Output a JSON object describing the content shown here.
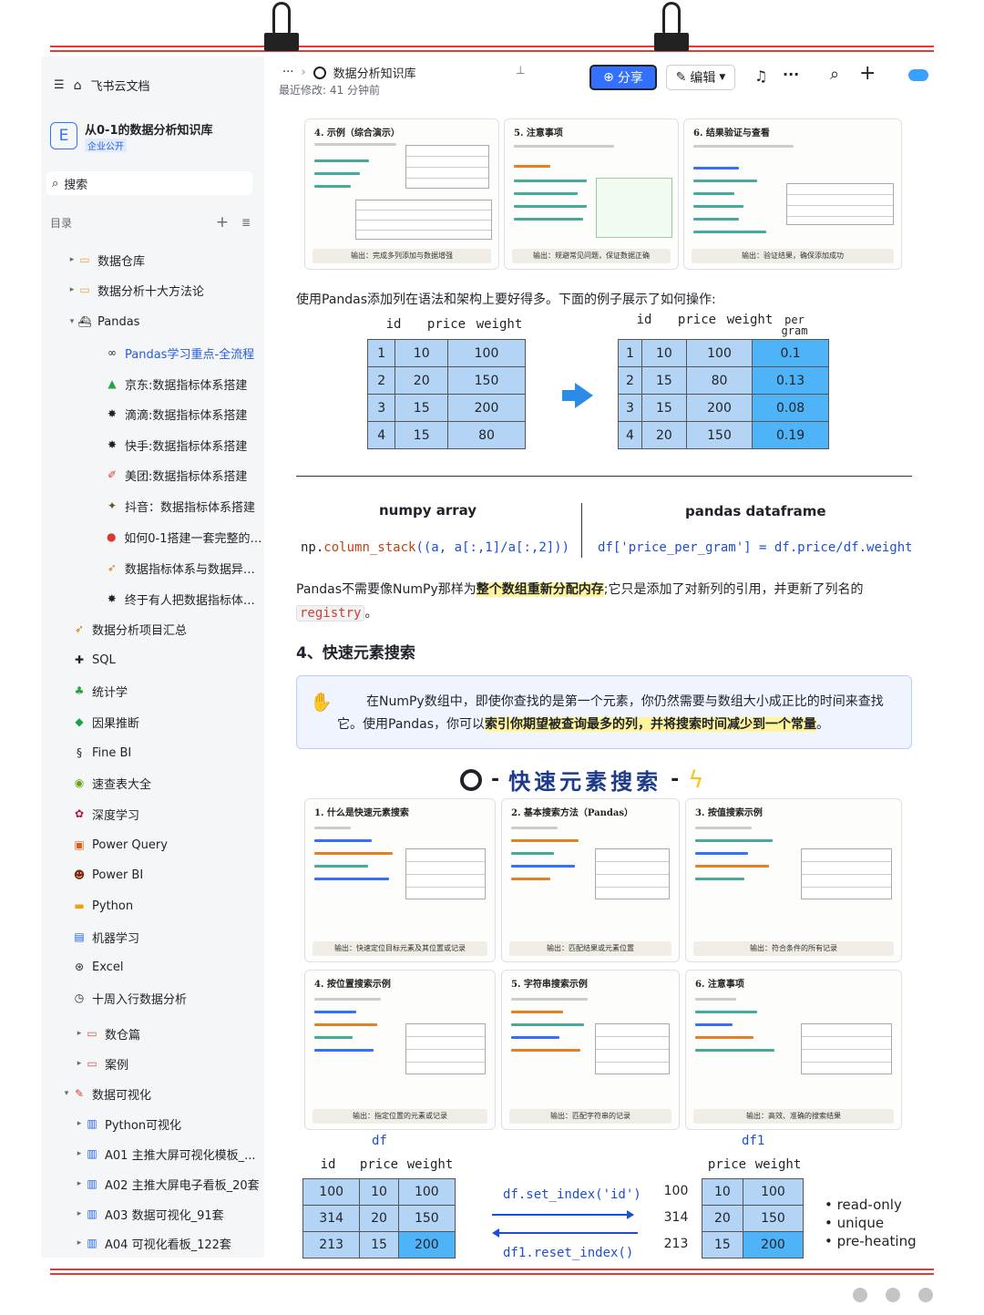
{
  "sidebar": {
    "app_name": "飞书云文档",
    "space_title": "从0-1的数据分析知识库",
    "space_badge": "企业公开",
    "space_letter": "E",
    "search_label": "搜索",
    "toc_label": "目录",
    "items": [
      {
        "label": "数据仓库",
        "icon": "folder-icon",
        "arrow": "▸",
        "indent": 1
      },
      {
        "label": "数据分析十大方法论",
        "icon": "folder-icon",
        "arrow": "▸",
        "indent": 1
      },
      {
        "label": "Pandas",
        "icon": "ship-icon",
        "arrow": "▾",
        "indent": 1
      },
      {
        "label": "Pandas学习重点-全流程",
        "icon": "infinity-icon",
        "arrow": "",
        "indent": 2,
        "active": true
      },
      {
        "label": "京东:数据指标体系搭建",
        "icon": "tree-icon",
        "arrow": "",
        "indent": 2
      },
      {
        "label": "滴滴:数据指标体系搭建",
        "icon": "gear-icon",
        "arrow": "",
        "indent": 2
      },
      {
        "label": "快手:数据指标体系搭建",
        "icon": "gear-icon",
        "arrow": "",
        "indent": 2
      },
      {
        "label": "美团:数据指标体系搭建",
        "icon": "pen-icon",
        "arrow": "",
        "indent": 2
      },
      {
        "label": "抖音：数据指标体系搭建",
        "icon": "sparkle-icon",
        "arrow": "",
        "indent": 2
      },
      {
        "label": "如何0-1搭建一套完整的数...",
        "icon": "pin-icon",
        "arrow": "",
        "indent": 2
      },
      {
        "label": "数据指标体系与数据异动...",
        "icon": "rocket-icon",
        "arrow": "",
        "indent": 2
      },
      {
        "label": "终于有人把数据指标体系...",
        "icon": "gear-icon",
        "arrow": "",
        "indent": 2
      },
      {
        "label": "数据分析项目汇总",
        "icon": "rocket-icon",
        "arrow": "",
        "indent": 0
      },
      {
        "label": "SQL",
        "icon": "puzzle-icon",
        "arrow": "",
        "indent": 0
      },
      {
        "label": "统计学",
        "icon": "plant-icon",
        "arrow": "",
        "indent": 0
      },
      {
        "label": "因果推断",
        "icon": "cake-icon",
        "arrow": "",
        "indent": 0
      },
      {
        "label": "Fine BI",
        "icon": "ribbon-icon",
        "arrow": "",
        "indent": 0
      },
      {
        "label": "速查表大全",
        "icon": "snail-icon",
        "arrow": "",
        "indent": 0
      },
      {
        "label": "深度学习",
        "icon": "butterfly-icon",
        "arrow": "",
        "indent": 0
      },
      {
        "label": "Power Query",
        "icon": "gift-icon",
        "arrow": "",
        "indent": 0
      },
      {
        "label": "Power BI",
        "icon": "alien-icon",
        "arrow": "",
        "indent": 0
      },
      {
        "label": "Python",
        "icon": "card-icon",
        "arrow": "",
        "indent": 0
      },
      {
        "label": "机器学习",
        "icon": "keyboard-icon",
        "arrow": "",
        "indent": 0
      },
      {
        "label": "Excel",
        "icon": "ball-icon",
        "arrow": "",
        "indent": 0
      },
      {
        "label": "十周入行数据分析",
        "icon": "clock-icon",
        "arrow": "",
        "indent": 0
      },
      {
        "label": "数仓篇",
        "icon": "folder-red-icon",
        "arrow": "▸",
        "indent": 1
      },
      {
        "label": "案例",
        "icon": "folder-red-icon",
        "arrow": "▸",
        "indent": 1
      },
      {
        "label": "数据可视化",
        "icon": "brush-icon",
        "arrow": "▾",
        "indent": 0
      },
      {
        "label": "Python可视化",
        "icon": "chart-icon",
        "arrow": "▸",
        "indent": 1
      },
      {
        "label": "A01 主推大屏可视化模板_...",
        "icon": "chart-icon",
        "arrow": "▸",
        "indent": 1
      },
      {
        "label": "A02 主推大屏电子看板_20套",
        "icon": "chart-icon",
        "arrow": "▸",
        "indent": 1
      },
      {
        "label": "A03 数据可视化_91套",
        "icon": "chart-icon",
        "arrow": "▸",
        "indent": 1
      },
      {
        "label": "A04 可视化看板_122套",
        "icon": "chart-icon",
        "arrow": "▸",
        "indent": 1
      }
    ]
  },
  "topbar": {
    "breadcrumb_more": "···",
    "breadcrumb_sep": "›",
    "doc_title": "数据分析知识库",
    "last_modified": "最近修改: 41 分钟前",
    "share_label": "分享",
    "edit_label": "编辑"
  },
  "cards_top": [
    {
      "title": "4. 示例（综合演示）",
      "footer": "输出：完成多列添加与数据增强"
    },
    {
      "title": "5. 注意事项",
      "footer": "输出：规避常见问题，保证数据正确"
    },
    {
      "title": "6. 结果验证与查看",
      "footer": "输出：验证结果，确保添加成功"
    }
  ],
  "para1": "使用Pandas添加列在语法和架构上要好得多。下面的例子展示了如何操作:",
  "table_left": {
    "headers": [
      "id",
      "price",
      "weight"
    ],
    "rows": [
      [
        "1",
        "10",
        "100"
      ],
      [
        "2",
        "20",
        "150"
      ],
      [
        "3",
        "15",
        "200"
      ],
      [
        "4",
        "15",
        "80"
      ]
    ]
  },
  "table_right": {
    "headers": [
      "id",
      "price",
      "weight",
      "per gram"
    ],
    "rows": [
      [
        "1",
        "10",
        "100",
        "0.1"
      ],
      [
        "2",
        "15",
        "80",
        "0.13"
      ],
      [
        "3",
        "15",
        "200",
        "0.08"
      ],
      [
        "4",
        "20",
        "150",
        "0.19"
      ]
    ]
  },
  "compare": {
    "left_title": "numpy array",
    "left_code_a": "np.",
    "left_code_b": "column_stack",
    "left_code_c": "((a, a[:,1]/a[:,2]))",
    "right_title": "pandas dataframe",
    "right_code_a": "df['price_per_gram']",
    "right_code_b": " = df.price/df.weight"
  },
  "para2_a": "Pandas不需要像NumPy那样为",
  "para2_hl": "整个数组重新分配内存",
  "para2_b": ";它只是添加了对新列的引用，并更新了列名的",
  "para2_code": "registry",
  "para2_end": "。",
  "heading4": "4、快速元素搜索",
  "callout": {
    "a": "在NumPy数组中，即使你查找的是第一个元素，你仍然需要与数组大小成正比的时间来查找它。使用Pandas，你可以",
    "hl": "索引你期望被查询最多的列，并将搜索时间减少到一个常量",
    "end": "。"
  },
  "banner_title": "快速元素搜索",
  "cards_bottom": [
    {
      "title": "1. 什么是快速元素搜索",
      "footer": "输出：快速定位目标元素及其位置或记录"
    },
    {
      "title": "2. 基本搜索方法（Pandas）",
      "footer": "输出：匹配结果或元素位置"
    },
    {
      "title": "3. 按值搜索示例",
      "footer": "输出：符合条件的所有记录"
    },
    {
      "title": "4. 按位置搜索示例",
      "footer": "输出：指定位置的元素或记录"
    },
    {
      "title": "5. 字符串搜索示例",
      "footer": "输出：匹配字符串的记录"
    },
    {
      "title": "6. 注意事项",
      "footer": "输出：高效、准确的搜索结果"
    }
  ],
  "index_demo": {
    "df_label": "df",
    "df1_label": "df1",
    "left_headers": [
      "id",
      "price",
      "weight"
    ],
    "left_rows": [
      [
        "100",
        "10",
        "100"
      ],
      [
        "314",
        "20",
        "150"
      ],
      [
        "213",
        "15",
        "200"
      ]
    ],
    "right_headers": [
      "price",
      "weight"
    ],
    "right_index": [
      "100",
      "314",
      "213"
    ],
    "right_rows": [
      [
        "10",
        "100"
      ],
      [
        "20",
        "150"
      ],
      [
        "15",
        "200"
      ]
    ],
    "set_index_code": "df.set_index('id')",
    "reset_index_code": "df1.reset_index()",
    "bullets": [
      "read-only",
      "unique",
      "pre-heating"
    ]
  },
  "colors": {
    "accent": "#3370ff",
    "table_fill": "#b3d4f5",
    "table_hl": "#4fb3f7",
    "red": "#e53935"
  }
}
